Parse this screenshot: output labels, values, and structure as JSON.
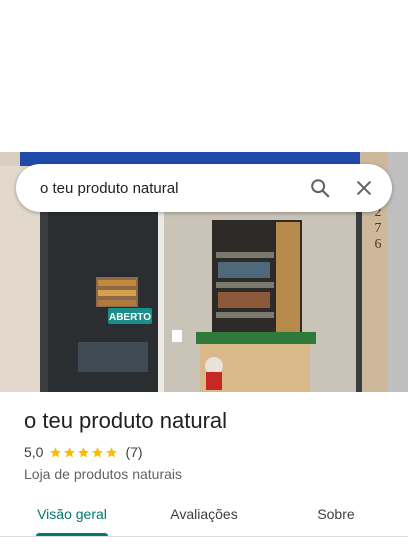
{
  "search": {
    "query": "o teu produto natural"
  },
  "photo": {
    "sign_text": "ABERTO",
    "number_text": "276"
  },
  "place": {
    "title": "o teu produto natural",
    "rating": "5,0",
    "stars": 5,
    "review_count": "(7)",
    "category": "Loja de produtos naturais"
  },
  "tabs": [
    {
      "label": "Visão geral",
      "active": true
    },
    {
      "label": "Avaliações",
      "active": false
    },
    {
      "label": "Sobre",
      "active": false
    }
  ],
  "colors": {
    "accent": "#00796b",
    "star": "#fbbc04",
    "sign": "#1a8f8a"
  },
  "icons": {
    "search": "search-icon",
    "close": "close-icon"
  }
}
